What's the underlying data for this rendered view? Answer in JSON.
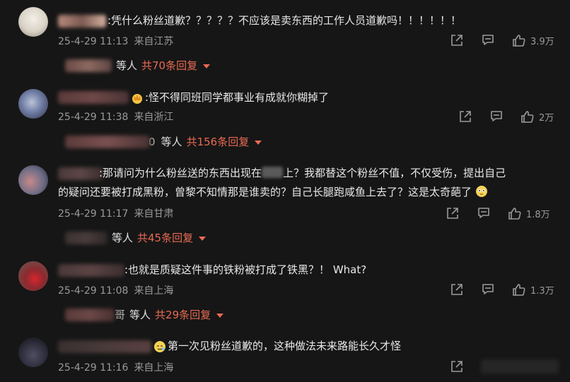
{
  "comments": [
    {
      "text": ":凭什么粉丝道歉？？？？？不应该是卖东西的工作人员道歉吗！！！！！！",
      "date": "25-4-29 11:13",
      "location": "来自江苏",
      "likes": "3.9万",
      "reply_people": "等人",
      "reply_count": "共70条回复"
    },
    {
      "text": ":怪不得同班同学都事业有成就你糊掉了",
      "date": "25-4-29 11:38",
      "location": "来自浙江",
      "likes": "2万",
      "reply_partial": "0",
      "reply_people": "等人",
      "reply_count": "共156条回复"
    },
    {
      "text_line1": ":那请问为什么粉丝送的东西出现在",
      "text_line1b": "上？我都替这个粉丝不值，不仅受伤，提出自己",
      "text_line2": "的疑问还要被打成黑粉，曾黎不知情那是谁卖的？自己长腿跑咸鱼上去了？这是太奇葩了",
      "date": "25-4-29 11:17",
      "location": "来自甘肃",
      "likes": "1.8万",
      "reply_people": "等人",
      "reply_count": "共45条回复"
    },
    {
      "text": ":也就是质疑这件事的铁粉被打成了铁黑？！ What?",
      "date": "25-4-29 11:08",
      "location": "来自上海",
      "likes": "1.3万",
      "reply_partial": "哥",
      "reply_people": "等人",
      "reply_count": "共29条回复"
    },
    {
      "text": "第一次见粉丝道歉的，这种做法未来路能长久才怪",
      "date": "25-4-29 11:16",
      "location": "来自上海"
    }
  ],
  "icons": {
    "share": "share-icon",
    "comment": "comment-icon",
    "like": "thumbs-up-icon"
  },
  "colors": {
    "background": "#161616",
    "accent": "#e96a52"
  }
}
